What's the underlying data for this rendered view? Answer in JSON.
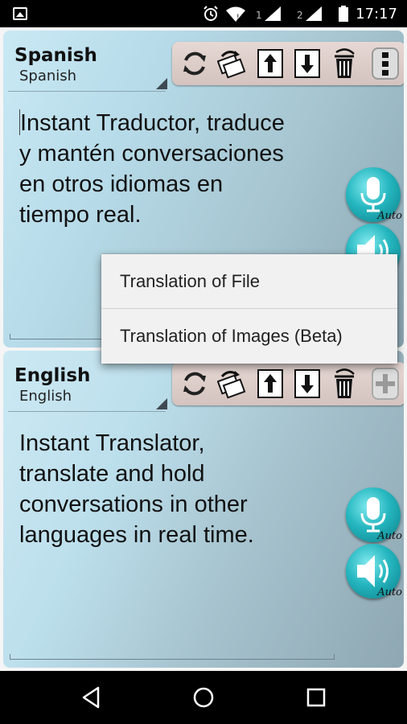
{
  "status_bar": {
    "time": "17:17",
    "sim1": "1",
    "sim2": "2",
    "icons": [
      "gallery-icon",
      "alarm-icon",
      "wifi-icon",
      "signal-icon",
      "signal-icon",
      "battery-icon"
    ]
  },
  "source_panel": {
    "language_title": "Spanish",
    "language_subtitle": "Spanish",
    "text": "Instant Traductor, traduce y  mantén conversaciones en otros idiomas en tiempo real.",
    "text_lines": [
      "Instant Traductor, traduce",
      "y  mantén conversaciones",
      "en otros idiomas en",
      "tiempo real."
    ],
    "mic_auto_label": "Auto",
    "toolbar_icons": [
      "refresh-icon",
      "swap-icon",
      "upload-icon",
      "download-icon",
      "trash-icon",
      "more-vertical-icon"
    ]
  },
  "target_panel": {
    "language_title": "English",
    "language_subtitle": "English",
    "text_lines": [
      "Instant Translator,",
      "translate and hold",
      "conversations in other",
      "languages in real time."
    ],
    "mic_auto_label": "Auto",
    "speaker_auto_label": "Auto",
    "toolbar_icons": [
      "refresh-icon",
      "swap-icon",
      "upload-icon",
      "download-icon",
      "trash-icon",
      "add-icon"
    ]
  },
  "popup_menu": {
    "items": [
      "Translation of File",
      "Translation of Images (Beta)"
    ]
  },
  "colors": {
    "accent_teal": "#25b6bf",
    "toolbar_bg": "#e0d1cd",
    "panel_light": "#c9e9f4",
    "panel_dark": "#8ba6b2"
  }
}
